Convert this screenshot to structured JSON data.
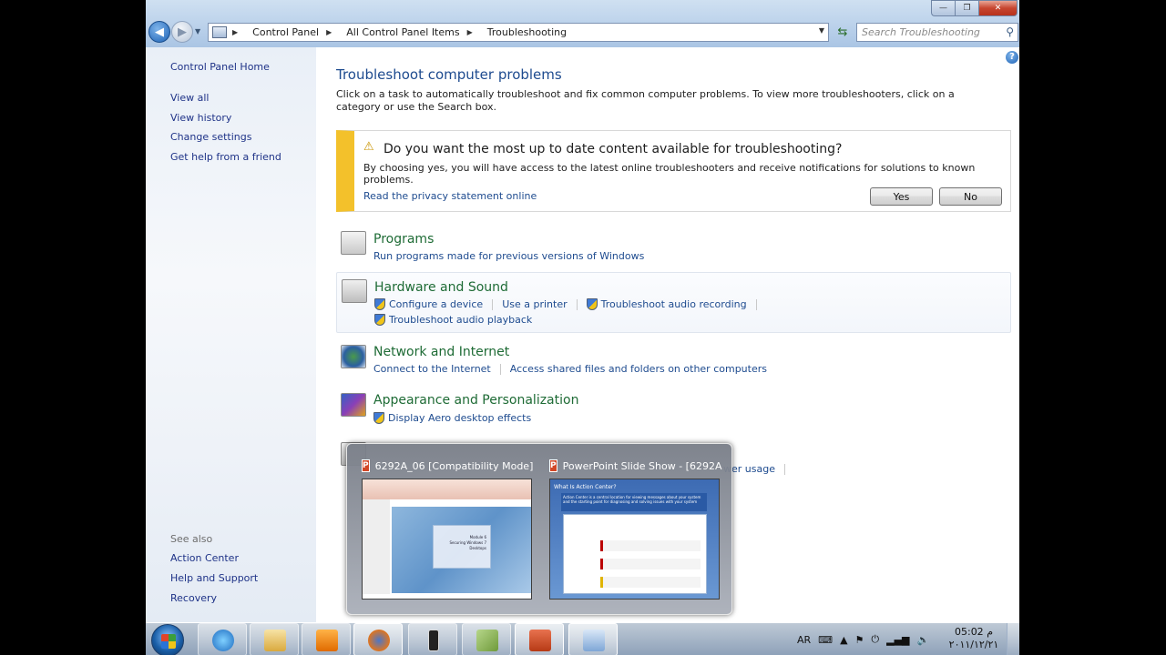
{
  "window": {
    "controls": {
      "minimize": "—",
      "maximize": "❐",
      "close": "✕"
    },
    "nav": {
      "back_icon": "arrow-left",
      "forward_icon": "arrow-right"
    },
    "breadcrumb": [
      "Control Panel",
      "All Control Panel Items",
      "Troubleshooting"
    ],
    "search_placeholder": "Search Troubleshooting"
  },
  "sidebar": {
    "home": "Control Panel Home",
    "links": [
      "View all",
      "View history",
      "Change settings",
      "Get help from a friend"
    ],
    "see_also_heading": "See also",
    "see_also": [
      "Action Center",
      "Help and Support",
      "Recovery"
    ]
  },
  "main": {
    "title": "Troubleshoot computer problems",
    "description": "Click on a task to automatically troubleshoot and fix common computer problems. To view more troubleshooters, click on a category or use the Search box.",
    "notice": {
      "question": "Do you want the most up to date content available for troubleshooting?",
      "detail": "By choosing yes, you will have access to the latest online troubleshooters and receive notifications for solutions to known problems.",
      "privacy_link": "Read the privacy statement online",
      "yes": "Yes",
      "no": "No",
      "accent_color": "#f3c12b"
    },
    "categories": [
      {
        "title": "Programs",
        "links": [
          "Run programs made for previous versions of Windows"
        ]
      },
      {
        "title": "Hardware and Sound",
        "links_row1": [
          "Configure a device",
          "Use a printer",
          "Troubleshoot audio recording"
        ],
        "links_row2": [
          "Troubleshoot audio playback"
        ]
      },
      {
        "title": "Network and Internet",
        "links": [
          "Connect to the Internet",
          "Access shared files and folders on other computers"
        ]
      },
      {
        "title": "Appearance and Personalization",
        "links": [
          "Display Aero desktop effects"
        ]
      },
      {
        "title": "",
        "links": [
          "wer usage"
        ]
      }
    ]
  },
  "thumbnails": [
    {
      "caption": "6292A_06 [Compatibility Mode] ...",
      "icon": "powerpoint-icon",
      "slide_lines": [
        "Module 6",
        "Securing Windows 7",
        "Desktops"
      ]
    },
    {
      "caption": "PowerPoint Slide Show - [6292A...",
      "icon": "powerpoint-icon",
      "slide_title": "What Is Action Center?",
      "slide_text": "Action Center is a central location for viewing messages about your system and the starting point for diagnosing and solving issues with your system"
    }
  ],
  "taskbar": {
    "apps": [
      "internet-explorer-icon",
      "windows-explorer-icon",
      "media-player-icon",
      "firefox-icon",
      "phone-device-icon",
      "notes-icon",
      "powerpoint-icon",
      "control-panel-icon"
    ],
    "lang": "AR",
    "time": "05:02 م",
    "date": "٢٠١١/١٢/٢١"
  }
}
